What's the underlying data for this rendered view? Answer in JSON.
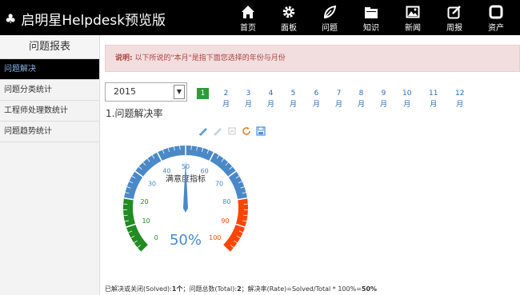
{
  "app": {
    "title": "启明星Helpdesk预览版"
  },
  "nav": [
    {
      "label": "首页",
      "icon": "home-icon"
    },
    {
      "label": "面板",
      "icon": "gear-icon"
    },
    {
      "label": "问题",
      "icon": "leaf-icon"
    },
    {
      "label": "知识",
      "icon": "folder-icon"
    },
    {
      "label": "新闻",
      "icon": "image-icon"
    },
    {
      "label": "周报",
      "icon": "edit-icon"
    },
    {
      "label": "资产",
      "icon": "box-icon"
    }
  ],
  "sidebar": {
    "title": "问题报表",
    "items": [
      {
        "label": "问题解决",
        "active": true
      },
      {
        "label": "问题分类统计",
        "active": false
      },
      {
        "label": "工程师处理数统计",
        "active": false
      },
      {
        "label": "问题趋势统计",
        "active": false
      }
    ]
  },
  "notice": {
    "prefix": "说明:",
    "text": "以下所说的\"本月\"是指下面您选择的年份与月份"
  },
  "filter": {
    "year": "2015",
    "months": [
      "1月",
      "2月",
      "3月",
      "4月",
      "5月",
      "6月",
      "7月",
      "8月",
      "9月",
      "10月",
      "11月",
      "12月"
    ],
    "active_month": "1月"
  },
  "section": {
    "title": "1.问题解决率"
  },
  "toolbox": [
    {
      "icon": "data-view-icon",
      "color": "#4a90d9"
    },
    {
      "icon": "restore-icon",
      "color": "#b9cfe6"
    },
    {
      "icon": "line-icon",
      "color": "#c0c0c0"
    },
    {
      "icon": "refresh-icon",
      "color": "#e27a2f"
    },
    {
      "icon": "save-icon",
      "color": "#4a90d9"
    }
  ],
  "chart_data": {
    "type": "gauge",
    "title": "满意度指标",
    "value": 50,
    "value_label": "50%",
    "min": 0,
    "max": 100,
    "tick_labels": [
      "0",
      "10",
      "20",
      "30",
      "40",
      "50",
      "60",
      "70",
      "80",
      "90",
      "100"
    ],
    "bands": [
      {
        "to": 20,
        "color": "#228b22"
      },
      {
        "to": 80,
        "color": "#4a89c8"
      },
      {
        "to": 100,
        "color": "#ff4500"
      }
    ]
  },
  "summary": {
    "solved_label": "已解决或关闭(Solved):",
    "solved_value": "1个",
    "total_label": "；问题总数(Total):",
    "total_value": "2",
    "rate_label": "；解决率(Rate)=Solved/Total * 100%=",
    "rate_value": "50%"
  }
}
